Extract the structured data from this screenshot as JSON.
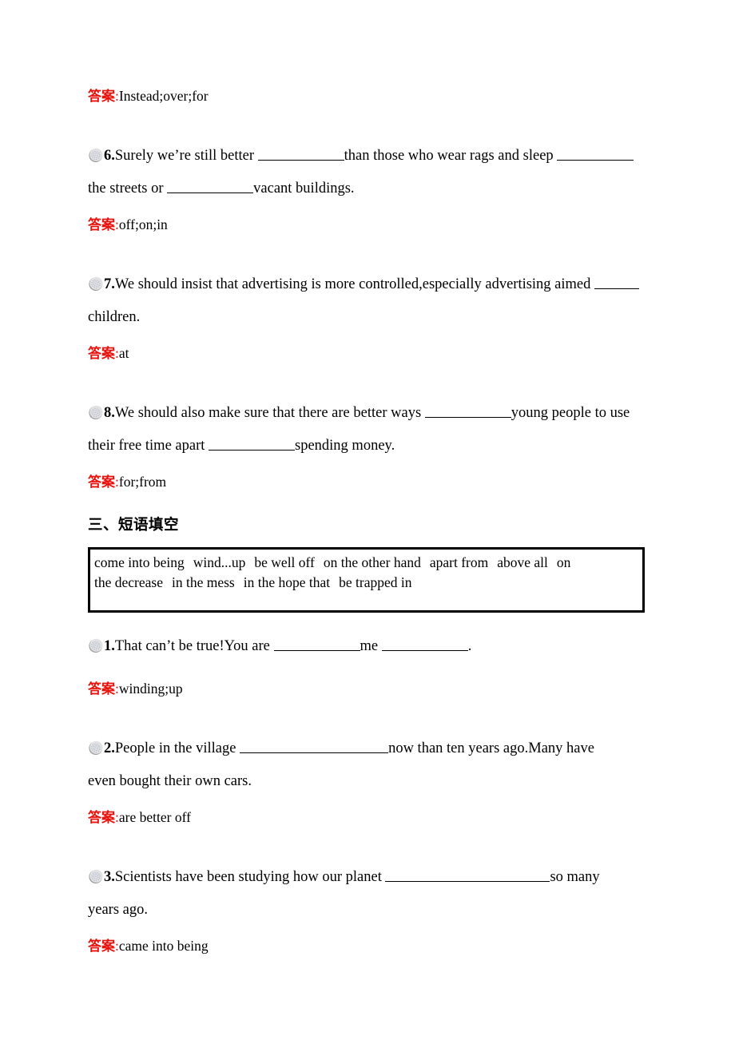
{
  "document": {
    "background": "#ffffff",
    "answer_label_color": "#e8120c",
    "text_color": "#000000",
    "bullet_icon_name": "dotted-sphere-bullet-icon"
  },
  "answer_label": "答案",
  "colon": ":",
  "answers": {
    "a5": "Instead;over;for",
    "a6": "off;on;in",
    "a7": "at",
    "a8": "for;from",
    "p1": "winding;up",
    "p2": "are better off",
    "p3": "came into being"
  },
  "questions": {
    "q6": {
      "number": "6.",
      "seg1": "Surely we’re still better ",
      "seg2": "than those who wear rags and sleep ",
      "seg3": "",
      "line2_seg1": "the streets or ",
      "line2_seg2": "vacant buildings."
    },
    "q7": {
      "number": "7.",
      "seg1": "We should insist that advertising is more controlled,especially advertising aimed ",
      "line2": "children."
    },
    "q8": {
      "number": "8.",
      "seg1": "We should also make sure that there are better ways ",
      "seg2": "young people to use",
      "line2_seg1": "their free time apart ",
      "line2_seg2": "spending money."
    },
    "p1": {
      "number": "1.",
      "seg1": "That can’t be true!You are ",
      "seg2": "me ",
      "seg3": "."
    },
    "p2": {
      "number": "2.",
      "seg1": "People in the village ",
      "seg2": "now than ten years ago.Many have",
      "line2": "even bought their own cars."
    },
    "p3": {
      "number": "3.",
      "seg1": "Scientists have been studying how our planet ",
      "seg2": "so many",
      "line2": "years ago."
    }
  },
  "section_three": {
    "heading": "三、短语填空"
  },
  "word_bank": {
    "line1": [
      "come into being",
      "wind...up",
      "be well off",
      "on the other hand",
      "apart from",
      "above all",
      "on"
    ],
    "line2": [
      "the decrease",
      "in the mess",
      "in the hope that",
      "be trapped in"
    ]
  }
}
